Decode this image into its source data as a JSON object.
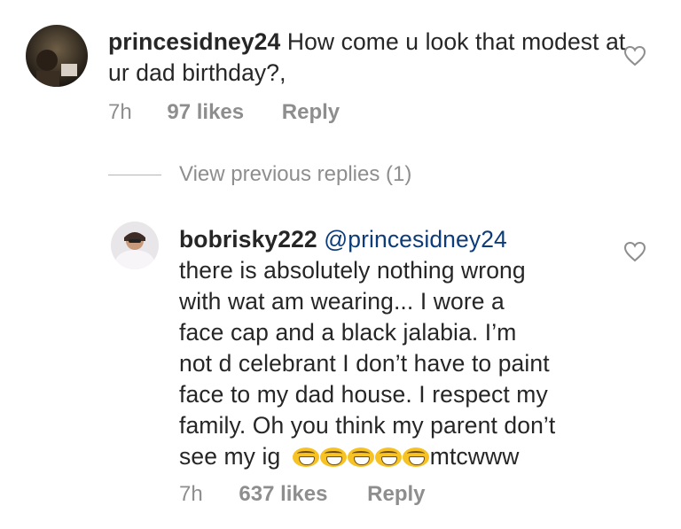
{
  "comments": [
    {
      "username": "princesidney24",
      "text": "How come u look that modest at ur dad birthday?,",
      "time": "7h",
      "likes": "97 likes",
      "reply": "Reply",
      "avatar_icon": "profile-photo-icon"
    }
  ],
  "view_previous_replies": "View previous replies (1)",
  "replies": [
    {
      "username": "bobrisky222",
      "mention": "@princesidney24",
      "text_line1": "there is absolutely nothing wrong",
      "text_line2": "with wat am wearing... I wore a",
      "text_line3": "face cap and a black jalabia. I’m",
      "text_line4": "not d celebrant I don’t have to paint",
      "text_line5": "face to my dad house. I respect my",
      "text_line6": "family. Oh you think my parent don’t",
      "text_line7_start": "see my ig",
      "text_line7_end": "mtcwww",
      "emojis": [
        "grinning-squint-emoji",
        "grinning-squint-emoji",
        "grinning-squint-emoji",
        "grinning-squint-emoji",
        "grinning-squint-emoji"
      ],
      "time": "7h",
      "likes": "637 likes",
      "reply": "Reply",
      "avatar_icon": "profile-photo-icon"
    }
  ],
  "colors": {
    "text": "#262626",
    "muted": "#8e8e8e",
    "mention": "#0c3c7a",
    "emoji": "#f7c224"
  }
}
